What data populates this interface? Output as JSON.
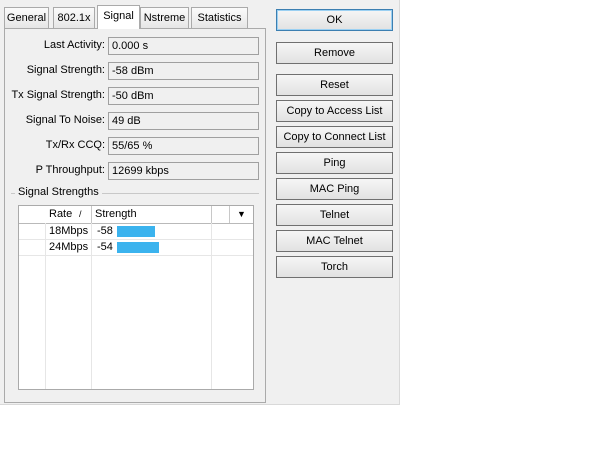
{
  "tabs": [
    {
      "label": "General",
      "active": false
    },
    {
      "label": "802.1x",
      "active": false
    },
    {
      "label": "Signal",
      "active": true
    },
    {
      "label": "Nstreme",
      "active": false
    },
    {
      "label": "Statistics",
      "active": false
    }
  ],
  "fields": [
    {
      "label": "Last Activity:",
      "value": "0.000 s"
    },
    {
      "label": "Signal Strength:",
      "value": "-58 dBm"
    },
    {
      "label": "Tx Signal Strength:",
      "value": "-50 dBm"
    },
    {
      "label": "Signal To Noise:",
      "value": "49 dB"
    },
    {
      "label": "Tx/Rx CCQ:",
      "value": "55/65 %"
    },
    {
      "label": "P Throughput:",
      "value": "12699 kbps"
    }
  ],
  "signal_group": {
    "title": "Signal Strengths",
    "columns": {
      "rate": "Rate",
      "sort_indicator": "/",
      "strength": "Strength"
    },
    "rows": [
      {
        "rate": "18Mbps",
        "strength": "-58",
        "bar_fraction": 0.45
      },
      {
        "rate": "24Mbps",
        "strength": "-54",
        "bar_fraction": 0.52
      }
    ],
    "bar_color": "#3bb3ee"
  },
  "buttons": [
    {
      "label": "OK",
      "default": true
    },
    {
      "label": "Remove"
    },
    {
      "label": "Reset"
    },
    {
      "label": "Copy to Access List"
    },
    {
      "label": "Copy to Connect List"
    },
    {
      "label": "Ping"
    },
    {
      "label": "MAC Ping"
    },
    {
      "label": "Telnet"
    },
    {
      "label": "MAC Telnet"
    },
    {
      "label": "Torch"
    }
  ]
}
